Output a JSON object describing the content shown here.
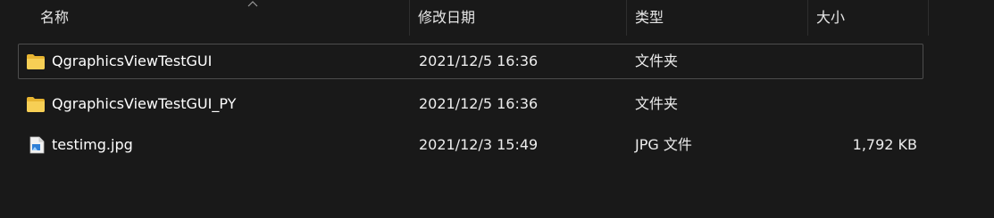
{
  "columns": {
    "name": "名称",
    "date": "修改日期",
    "type": "类型",
    "size": "大小"
  },
  "sort": {
    "column": "name",
    "icon": "sort-up-chevron-icon"
  },
  "rows": [
    {
      "name": "QgraphicsViewTestGUI",
      "date": "2021/12/5 16:36",
      "type": "文件夹",
      "size": "",
      "icon": "folder-icon",
      "selected": true
    },
    {
      "name": "QgraphicsViewTestGUI_PY",
      "date": "2021/12/5 16:36",
      "type": "文件夹",
      "size": "",
      "icon": "folder-icon",
      "selected": false
    },
    {
      "name": "testimg.jpg",
      "date": "2021/12/3 15:49",
      "type": "JPG 文件",
      "size": "1,792 KB",
      "icon": "image-file-icon",
      "selected": false
    }
  ],
  "colors": {
    "background": "#191919",
    "folder": "#f4c542",
    "selection_border": "#4d4d4d"
  }
}
